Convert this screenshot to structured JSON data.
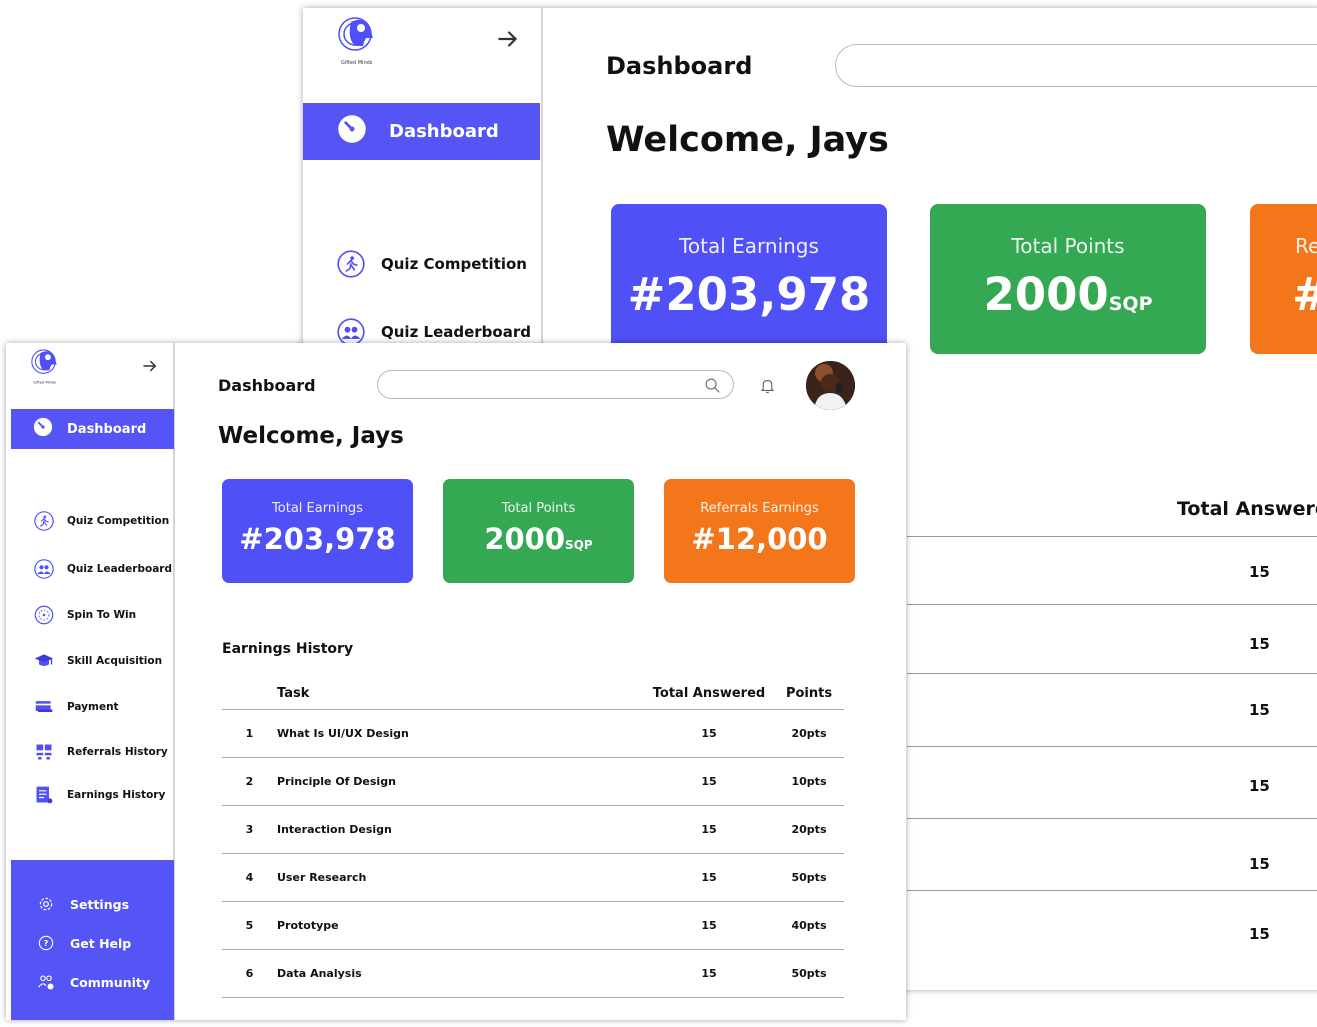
{
  "app": {
    "brand_logo_text": "Gifted Minds",
    "page_title": "Dashboard",
    "welcome": "Welcome, Jays",
    "search_placeholder": ""
  },
  "sidebar": {
    "active": {
      "label": "Dashboard",
      "icon": "speedometer-icon"
    },
    "items": [
      {
        "label": "Quiz Competition",
        "icon": "running-person-icon"
      },
      {
        "label": "Quiz Leaderboard",
        "icon": "users-icon"
      },
      {
        "label": "Spin To Win",
        "icon": "wheel-icon"
      },
      {
        "label": "Skill Acquisition",
        "icon": "graduation-cap-icon"
      },
      {
        "label": "Payment",
        "icon": "card-icon"
      },
      {
        "label": "Referrals History",
        "icon": "grid-people-icon"
      },
      {
        "label": "Earnings History",
        "icon": "document-list-icon"
      }
    ],
    "bottom": [
      {
        "label": "Settings",
        "icon": "gear-icon"
      },
      {
        "label": "Get Help",
        "icon": "help-circle-icon"
      },
      {
        "label": "Community",
        "icon": "community-icon"
      }
    ]
  },
  "cards": [
    {
      "label": "Total Earnings",
      "value": "#203,978",
      "suffix": "",
      "color": "#5050f7"
    },
    {
      "label": "Total Points",
      "value": "2000",
      "suffix": "SQP",
      "color": "#34a853"
    },
    {
      "label": "Referrals Earnings",
      "value": "#12,000",
      "suffix": "",
      "color": "#f4761b"
    }
  ],
  "back_partial": {
    "card3_label_fragment": "Re",
    "card3_value_fragment": "#",
    "column_header": "Total Answere",
    "values": [
      "15",
      "15",
      "15",
      "15",
      "15",
      "15"
    ]
  },
  "earnings_history": {
    "title": "Earnings History",
    "columns": [
      "",
      "Task",
      "Total Answered",
      "Points"
    ],
    "rows": [
      {
        "no": "1",
        "task": "What Is UI/UX Design",
        "answered": "15",
        "points": "20pts"
      },
      {
        "no": "2",
        "task": "Principle Of Design",
        "answered": "15",
        "points": "10pts"
      },
      {
        "no": "3",
        "task": "Interaction Design",
        "answered": "15",
        "points": "20pts"
      },
      {
        "no": "4",
        "task": "User Research",
        "answered": "15",
        "points": "50pts"
      },
      {
        "no": "5",
        "task": "Prototype",
        "answered": "15",
        "points": "40pts"
      },
      {
        "no": "6",
        "task": "Data Analysis",
        "answered": "15",
        "points": "50pts"
      }
    ]
  }
}
